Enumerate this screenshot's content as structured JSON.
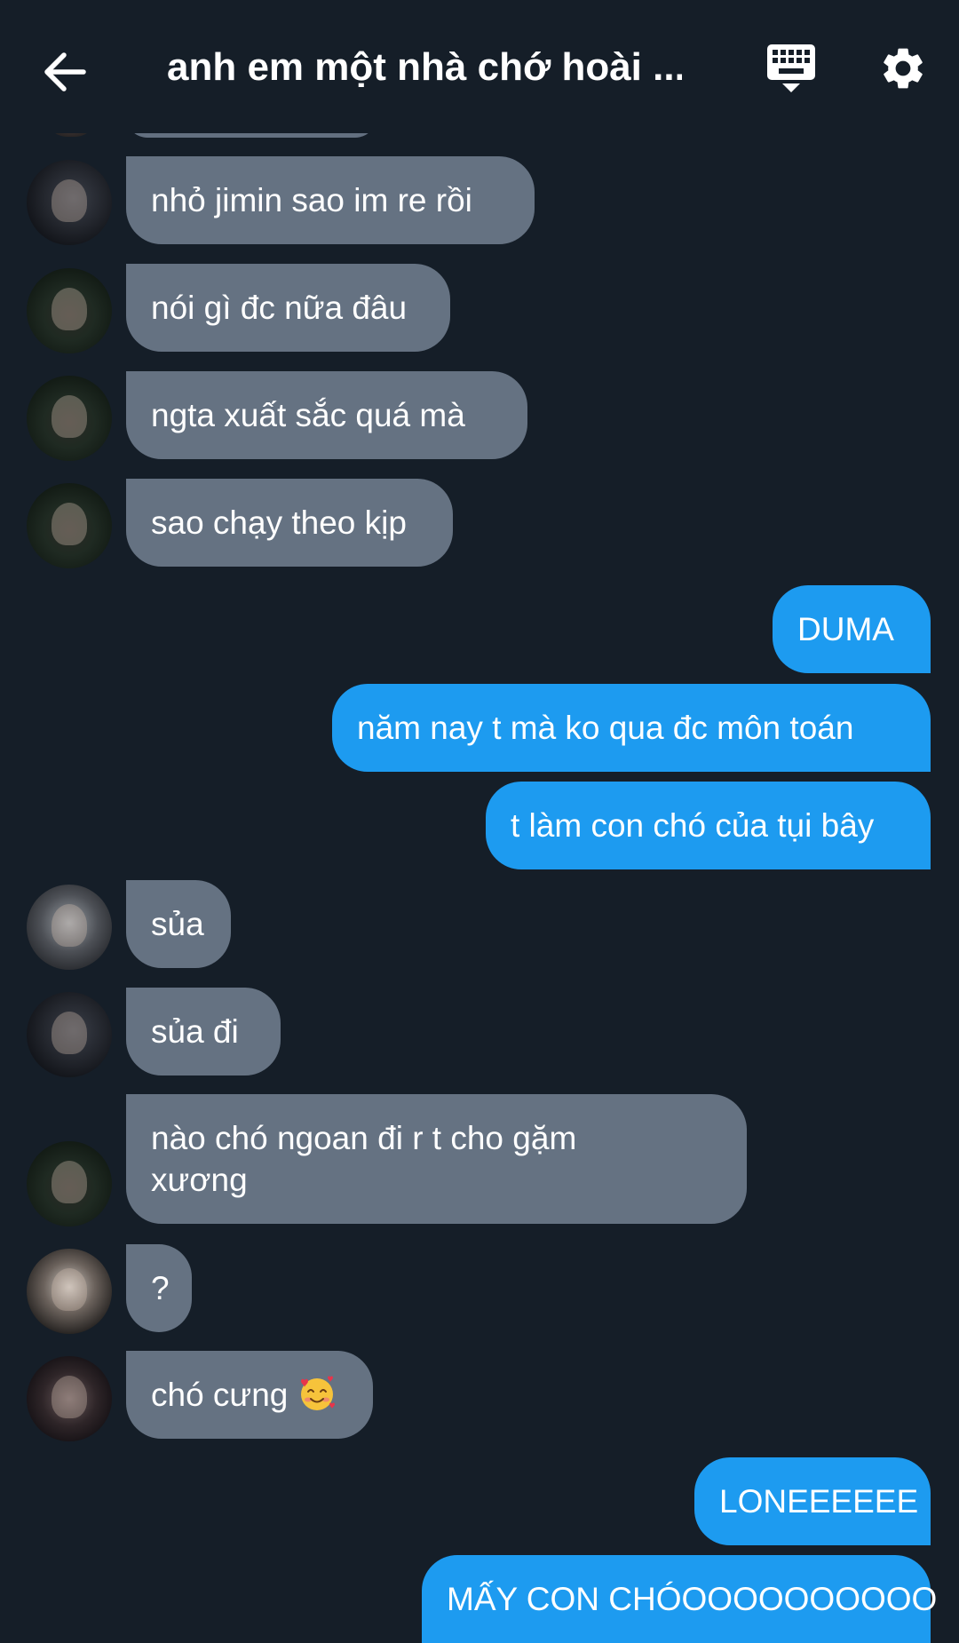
{
  "header": {
    "title": "anh em một nhà chớ hoài ...",
    "back_icon": "arrow-left-icon",
    "keyboard_icon": "keyboard-icon",
    "settings_icon": "gear-icon"
  },
  "colors": {
    "background": "#151e28",
    "incoming_bubble": "#657282",
    "outgoing_bubble": "#1d9bf0",
    "text": "#ffffff"
  },
  "messages": [
    {
      "side": "in",
      "text": "nhỏ jimin sao im re rồi"
    },
    {
      "side": "in",
      "text": "nói gì đc nữa đâu"
    },
    {
      "side": "in",
      "text": "ngta xuất sắc quá mà"
    },
    {
      "side": "in",
      "text": "sao chạy theo kịp"
    },
    {
      "side": "out",
      "text": "DUMA"
    },
    {
      "side": "out",
      "text": "năm nay t mà ko qua đc môn toán"
    },
    {
      "side": "out",
      "text": "t làm con chó của tụi bây"
    },
    {
      "side": "in",
      "text": "sủa"
    },
    {
      "side": "in",
      "text": "sủa đi"
    },
    {
      "side": "in",
      "text": "nào chó ngoan đi r t cho gặm xương"
    },
    {
      "side": "in",
      "text": "?"
    },
    {
      "side": "in",
      "text": "chó cưng",
      "emoji": "smiling-face-with-hearts-emoji"
    },
    {
      "side": "out",
      "text": "LONEEEEEE"
    },
    {
      "side": "out",
      "text": "MẤY CON CHÓOOOOOOOOOO"
    }
  ]
}
